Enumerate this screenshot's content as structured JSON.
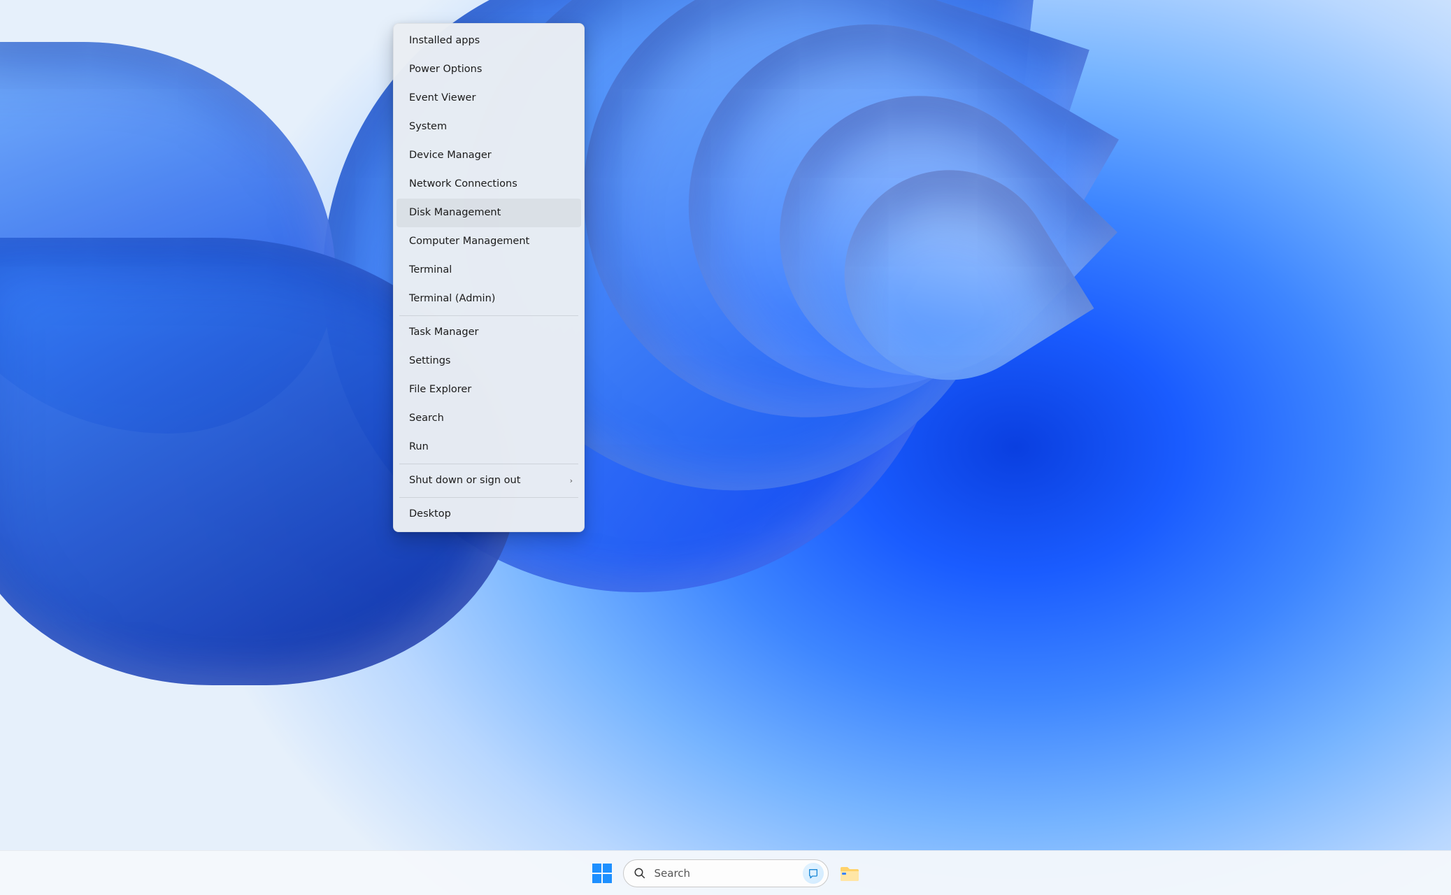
{
  "quick_menu": {
    "groups": [
      [
        {
          "label": "Installed apps",
          "has_submenu": false,
          "hovered": false
        },
        {
          "label": "Power Options",
          "has_submenu": false,
          "hovered": false
        },
        {
          "label": "Event Viewer",
          "has_submenu": false,
          "hovered": false
        },
        {
          "label": "System",
          "has_submenu": false,
          "hovered": false
        },
        {
          "label": "Device Manager",
          "has_submenu": false,
          "hovered": false
        },
        {
          "label": "Network Connections",
          "has_submenu": false,
          "hovered": false
        },
        {
          "label": "Disk Management",
          "has_submenu": false,
          "hovered": true
        },
        {
          "label": "Computer Management",
          "has_submenu": false,
          "hovered": false
        },
        {
          "label": "Terminal",
          "has_submenu": false,
          "hovered": false
        },
        {
          "label": "Terminal (Admin)",
          "has_submenu": false,
          "hovered": false
        }
      ],
      [
        {
          "label": "Task Manager",
          "has_submenu": false,
          "hovered": false
        },
        {
          "label": "Settings",
          "has_submenu": false,
          "hovered": false
        },
        {
          "label": "File Explorer",
          "has_submenu": false,
          "hovered": false
        },
        {
          "label": "Search",
          "has_submenu": false,
          "hovered": false
        },
        {
          "label": "Run",
          "has_submenu": false,
          "hovered": false
        }
      ],
      [
        {
          "label": "Shut down or sign out",
          "has_submenu": true,
          "hovered": false
        }
      ],
      [
        {
          "label": "Desktop",
          "has_submenu": false,
          "hovered": false
        }
      ]
    ]
  },
  "taskbar": {
    "search_placeholder": "Search",
    "items": {
      "start": "start-button",
      "search": "search-box",
      "bing": "bing-chat-icon",
      "file_explorer": "file-explorer-icon"
    }
  }
}
